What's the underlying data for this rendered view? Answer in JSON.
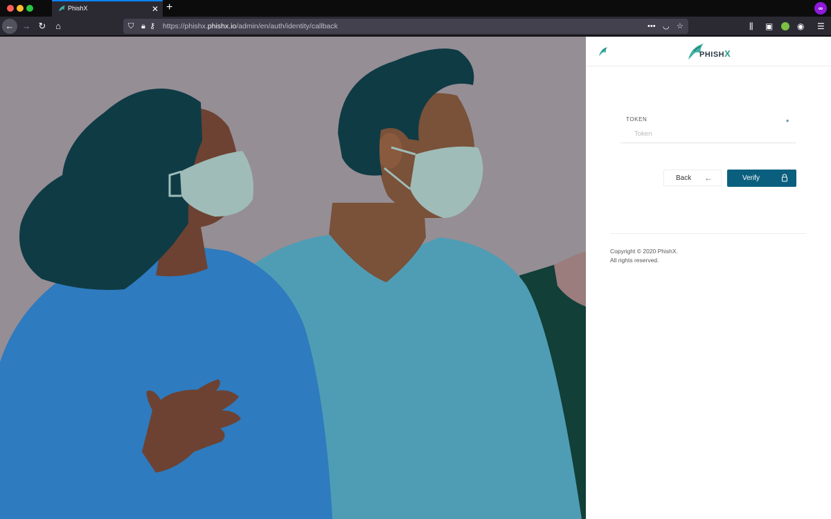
{
  "browser": {
    "tab_title": "PhishX",
    "tab_close": "✕",
    "new_tab": "+",
    "url_prefix": "https://phishx.",
    "url_domain": "phishx.io",
    "url_path": "/admin/en/auth/identity/callback",
    "icons": [
      "back-arrow-icon",
      "forward-arrow-icon",
      "reload-icon",
      "home-icon",
      "shield-icon",
      "lock-icon",
      "key-icon",
      "more-icon",
      "pocket-icon",
      "star-icon",
      "library-icon",
      "sidebar-icon",
      "extension-icon",
      "account-icon",
      "menu-icon",
      "private-mask-icon"
    ]
  },
  "panel": {
    "brand": {
      "name": "PHISH",
      "accent": "X"
    },
    "token_label": "TOKEN",
    "token_required": "*",
    "token_placeholder": "Token",
    "token_value": "",
    "back_label": "Back",
    "verify_label": "Verify",
    "copyright_line1": "Copyright © 2020 PhishX.",
    "copyright_line2": "All rights reserved."
  },
  "colors": {
    "primary": "#0b5f7e",
    "hero_bg": "#958e95",
    "brand_teal": "#2a9a8a"
  }
}
